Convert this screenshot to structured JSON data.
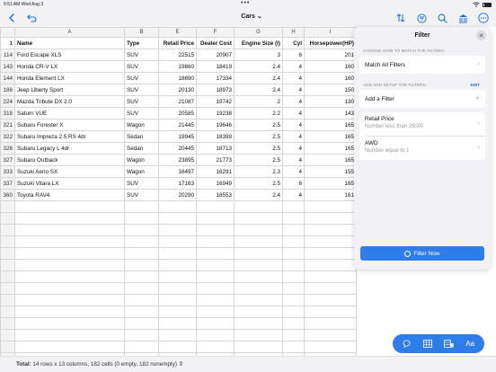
{
  "status_bar": {
    "time": "9:51 AM",
    "date": "Wed Aug 3",
    "dots": "•••"
  },
  "nav": {
    "title": "Cars",
    "title_suffix": "⌄",
    "icons": {
      "back": "chevron-left-icon",
      "undo": "undo-icon",
      "sort": "sort-icon",
      "filter": "filter-icon",
      "search": "search-icon",
      "library": "library-icon",
      "more": "more-icon"
    }
  },
  "grid": {
    "column_letters": [
      "",
      "A",
      "B",
      "E",
      "F",
      "G",
      "H",
      "I"
    ],
    "header_row_num": "1",
    "headers": [
      "Name",
      "Type",
      "Retail Price",
      "Dealer Cost",
      "Engine Size (l)",
      "Cyl",
      "Horsepower(HP)"
    ],
    "rows": [
      {
        "num": "114",
        "name": "Ford Escape XLS",
        "type": "SUV",
        "price": "22515",
        "cost": "20907",
        "engine": "3",
        "cyl": "6",
        "hp": "201"
      },
      {
        "num": "143",
        "name": "Honda CR-V LX",
        "type": "SUV",
        "price": "19860",
        "cost": "18419",
        "engine": "2.4",
        "cyl": "4",
        "hp": "160"
      },
      {
        "num": "144",
        "name": "Honda Element LX",
        "type": "SUV",
        "price": "18690",
        "cost": "17334",
        "engine": "2.4",
        "cyl": "4",
        "hp": "160"
      },
      {
        "num": "186",
        "name": "Jeep Liberty Sport",
        "type": "SUV",
        "price": "20130",
        "cost": "18973",
        "engine": "2.4",
        "cyl": "4",
        "hp": "150"
      },
      {
        "num": "224",
        "name": "Mazda Tribute DX 2.0",
        "type": "SUV",
        "price": "21087",
        "cost": "19742",
        "engine": "2",
        "cyl": "4",
        "hp": "130"
      },
      {
        "num": "318",
        "name": "Saturn VUE",
        "type": "SUV",
        "price": "20585",
        "cost": "19238",
        "engine": "2.2",
        "cyl": "4",
        "hp": "143"
      },
      {
        "num": "321",
        "name": "Subaru Forester X",
        "type": "Wagon",
        "price": "21445",
        "cost": "19646",
        "engine": "2.5",
        "cyl": "4",
        "hp": "165"
      },
      {
        "num": "322",
        "name": "Subaru Impreza 2.5 RS 4dr",
        "type": "Sedan",
        "price": "19945",
        "cost": "18399",
        "engine": "2.5",
        "cyl": "4",
        "hp": "165"
      },
      {
        "num": "326",
        "name": "Subaru Legacy L 4dr",
        "type": "Sedan",
        "price": "20445",
        "cost": "18713",
        "engine": "2.5",
        "cyl": "4",
        "hp": "165"
      },
      {
        "num": "327",
        "name": "Subaru Outback",
        "type": "Wagon",
        "price": "23895",
        "cost": "21773",
        "engine": "2.5",
        "cyl": "4",
        "hp": "165"
      },
      {
        "num": "333",
        "name": "Suzuki Aerio SX",
        "type": "Wagon",
        "price": "16497",
        "cost": "16291",
        "engine": "2.3",
        "cyl": "4",
        "hp": "155"
      },
      {
        "num": "337",
        "name": "Suzuki Vitara LX",
        "type": "SUV",
        "price": "17163",
        "cost": "16949",
        "engine": "2.5",
        "cyl": "6",
        "hp": "165"
      },
      {
        "num": "360",
        "name": "Toyota RAV4",
        "type": "SUV",
        "price": "20290",
        "cost": "18553",
        "engine": "2.4",
        "cyl": "4",
        "hp": "161"
      }
    ]
  },
  "filter_panel": {
    "title": "Filter",
    "close_glyph": "✕",
    "section_match": "CHOOSE HOW TO MATCH THE FILTERS:",
    "match_option": "Match All Filters",
    "section_setup": "ADD AND SETUP THE FILTERS:",
    "edit_label": "EDIT",
    "add_filter": "Add a Filter",
    "filters": [
      {
        "field": "Retail Price",
        "condition": "Number less than 25000"
      },
      {
        "field": "AWD",
        "condition": "Number equal to 1"
      }
    ],
    "apply_button": "Filter Now"
  },
  "toolbar": {
    "icons": [
      "comment-icon",
      "table-icon",
      "form-view-icon",
      "text-format-icon"
    ],
    "text_format_label": "Aa"
  },
  "footer": {
    "label": "Total:",
    "summary": "14 rows x 13 columns, 182 cells (0 empty, 182 nonempty)",
    "stepper_glyph": "⇕"
  }
}
